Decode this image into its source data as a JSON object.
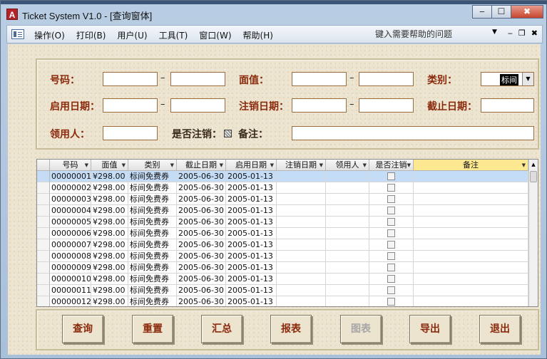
{
  "window": {
    "title": "Ticket System V1.0 - [查询窗体]",
    "app_icon_letter": "A",
    "buttons": [
      "‒",
      "☐",
      "✖"
    ]
  },
  "menubar": {
    "items": [
      "操作(O)",
      "打印(B)",
      "用户(U)",
      "工具(T)",
      "窗口(W)",
      "帮助(H)"
    ],
    "help_placeholder": "键入需要帮助的问题",
    "mdi_buttons": [
      "‒",
      "❐",
      "✖"
    ]
  },
  "search": {
    "number_label": "号码：",
    "face_value_label": "面值：",
    "category_label": "类别：",
    "category_value": "标间",
    "start_date_label": "启用日期：",
    "cancel_date_label": "注销日期：",
    "deadline_label": "截止日期：",
    "receiver_label": "领用人：",
    "is_cancelled_label": "是否注销：",
    "remarks_label": "备注：",
    "range_separator": "–"
  },
  "grid": {
    "columns": [
      "号码",
      "面值",
      "类别",
      "截止日期",
      "启用日期",
      "注销日期",
      "领用人",
      "是否注销",
      "备注"
    ],
    "rows": [
      [
        "00000001",
        "¥298.00",
        "标间免费券",
        "2005-06-30",
        "2005-01-13",
        "",
        "",
        "",
        ""
      ],
      [
        "00000002",
        "¥298.00",
        "标间免费券",
        "2005-06-30",
        "2005-01-13",
        "",
        "",
        "",
        ""
      ],
      [
        "00000003",
        "¥298.00",
        "标间免费券",
        "2005-06-30",
        "2005-01-13",
        "",
        "",
        "",
        ""
      ],
      [
        "00000004",
        "¥298.00",
        "标间免费券",
        "2005-06-30",
        "2005-01-13",
        "",
        "",
        "",
        ""
      ],
      [
        "00000005",
        "¥298.00",
        "标间免费券",
        "2005-06-30",
        "2005-01-13",
        "",
        "",
        "",
        ""
      ],
      [
        "00000006",
        "¥298.00",
        "标间免费券",
        "2005-06-30",
        "2005-01-13",
        "",
        "",
        "",
        ""
      ],
      [
        "00000007",
        "¥298.00",
        "标间免费券",
        "2005-06-30",
        "2005-01-13",
        "",
        "",
        "",
        ""
      ],
      [
        "00000008",
        "¥298.00",
        "标间免费券",
        "2005-06-30",
        "2005-01-13",
        "",
        "",
        "",
        ""
      ],
      [
        "00000009",
        "¥298.00",
        "标间免费券",
        "2005-06-30",
        "2005-01-13",
        "",
        "",
        "",
        ""
      ],
      [
        "00000010",
        "¥298.00",
        "标间免费券",
        "2005-06-30",
        "2005-01-13",
        "",
        "",
        "",
        ""
      ],
      [
        "00000011",
        "¥298.00",
        "标间免费券",
        "2005-06-30",
        "2005-01-13",
        "",
        "",
        "",
        ""
      ],
      [
        "00000012",
        "¥298.00",
        "标间免费券",
        "2005-06-30",
        "2005-01-13",
        "",
        "",
        "",
        ""
      ]
    ]
  },
  "actions": {
    "query": "查询",
    "reset": "重置",
    "summary": "汇总",
    "report": "报表",
    "chart": "图表",
    "export": "导出",
    "exit": "退出"
  }
}
